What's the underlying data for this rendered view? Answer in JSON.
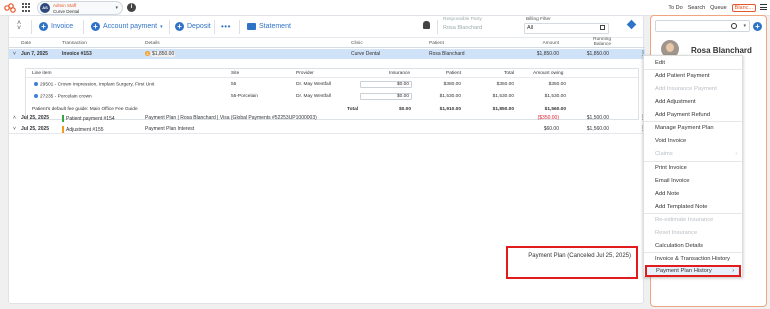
{
  "topbar": {
    "staff_name": "Admin Staff",
    "practice": "Curve Dental",
    "avatar_initials": "AS",
    "links": [
      "To Do",
      "Search",
      "Queue"
    ],
    "active_tab": "Blanc..."
  },
  "toolbar": {
    "invoice": "Invoice",
    "account_payment": "Account payment",
    "deposit": "Deposit",
    "more": "•••",
    "statement": "Statement",
    "responsible_party_label": "Responsible Party",
    "responsible_party_value": "Rosa Blanchard",
    "billing_filter_label": "Billing Filter",
    "billing_filter_value": "All"
  },
  "columns": {
    "date": "Date",
    "transaction": "Transaction",
    "details": "Details",
    "clinic": "Clinic",
    "patient": "Patient",
    "amount": "Amount",
    "running_balance": "Running Balance"
  },
  "rows": {
    "invoice": {
      "date": "Jun 7, 2025",
      "transaction": "Invoice #153",
      "details": "$1,850.00",
      "clinic": "Curve Dental",
      "patient": "Rosa Blanchard",
      "amount": "$1,850.00",
      "balance": "$1,850.00"
    },
    "payment": {
      "date": "Jul 25, 2025",
      "transaction": "Patient payment #154",
      "details": "Payment Plan | Rosa Blanchard | Visa (Global Payments #52253UP1000003)",
      "amount": "($350.00)",
      "balance": "$1,500.00"
    },
    "adjustment": {
      "date": "Jul 25, 2025",
      "transaction": "Adjustment #155",
      "details": "Payment Plan Interest",
      "amount": "$60.00",
      "balance": "$1,560.00"
    }
  },
  "lineitems": {
    "headers": {
      "line_item": "Line item",
      "site": "Site",
      "provider": "Provider",
      "insurance": "Insurance",
      "patient": "Patient",
      "total": "Total",
      "amount_owing": "Amount owing"
    },
    "items": [
      {
        "desc": "29501 - Crown Impression, Implant Surgery, First Unit",
        "site": "55",
        "provider": "Dr. May Westfall",
        "insurance": "$0.00",
        "patient": "$380.00",
        "total": "$350.00",
        "owing": "$350.00"
      },
      {
        "desc": "27235 - Porcelain crown",
        "site": "55-Porcelain",
        "provider": "Dr. May Westfall",
        "insurance": "$0.00",
        "patient": "$1,530.00",
        "total": "$1,530.00",
        "owing": "$1,530.00"
      }
    ],
    "fee_guide": "Patient's default fee guide: Main Office Fee Guide",
    "total_label": "Total",
    "total_insurance": "$0.00",
    "total_patient": "$1,910.00",
    "total_total": "$1,850.00",
    "total_owing": "$1,560.00"
  },
  "note": "Payment Plan (Canceled Jul 25, 2025)",
  "patient_panel": {
    "name": "Rosa Blanchard"
  },
  "context_menu": {
    "items": [
      "Edit",
      "Add Patient Payment",
      "Add Insurance Payment",
      "Add Adjustment",
      "Add Payment Refund",
      "Manage Payment Plan",
      "Void Invoice",
      "Claims",
      "Print Invoice",
      "Email Invoice",
      "Add Note",
      "Add Templated Note",
      "Re-estimate Insurance",
      "Reset Insurance",
      "Calculation Details",
      "Invoice & Transaction History",
      "Payment Plan History"
    ],
    "submenu_arrow": "›"
  },
  "colors": {
    "accent_blue": "#2f73c7",
    "brand_orange": "#e4592b",
    "highlight_red": "#e01c1c",
    "selected_row": "#cfe2f7"
  },
  "icons": {
    "logo": "curve-logo-icon",
    "apps": "apps-grid-icon",
    "info": "info-icon",
    "sort": "sort-arrows-icon",
    "print": "printer-icon",
    "bell": "bell-icon",
    "calendar": "calendar-icon",
    "box": "box-icon",
    "search": "search-icon",
    "add": "plus-icon",
    "menu": "hamburger-icon"
  }
}
